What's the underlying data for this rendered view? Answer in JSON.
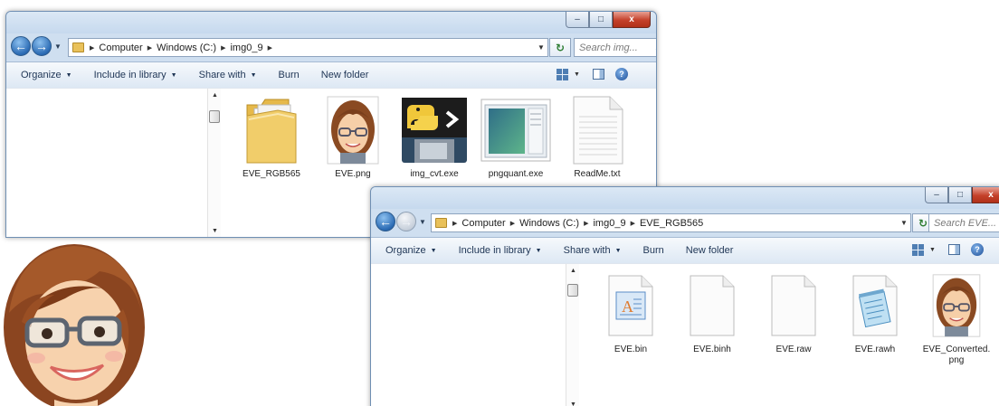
{
  "window1": {
    "caption": {
      "minimize": "–",
      "maximize": "□",
      "close": "x"
    },
    "address": {
      "crumbs": [
        "Computer",
        "Windows (C:)",
        "img0_9"
      ]
    },
    "search": {
      "placeholder": "Search img..."
    },
    "toolbar": {
      "items": [
        "Organize",
        "Include in library",
        "Share with",
        "Burn",
        "New folder"
      ]
    },
    "files": [
      {
        "name": "EVE_RGB565",
        "icon": "folder-icon"
      },
      {
        "name": "EVE.png",
        "icon": "eve-avatar-icon"
      },
      {
        "name": "img_cvt.exe",
        "icon": "python-floppy-icon"
      },
      {
        "name": "pngquant.exe",
        "icon": "app-window-icon"
      },
      {
        "name": "ReadMe.txt",
        "icon": "text-file-icon"
      }
    ]
  },
  "window2": {
    "caption": {
      "minimize": "–",
      "maximize": "□",
      "close": "x"
    },
    "address": {
      "crumbs": [
        "Computer",
        "Windows (C:)",
        "img0_9",
        "EVE_RGB565"
      ]
    },
    "search": {
      "placeholder": "Search EVE..."
    },
    "toolbar": {
      "items": [
        "Organize",
        "Include in library",
        "Share with",
        "Burn",
        "New folder"
      ]
    },
    "files": [
      {
        "name": "EVE.bin",
        "icon": "bin-file-icon"
      },
      {
        "name": "EVE.binh",
        "icon": "blank-file-icon"
      },
      {
        "name": "EVE.raw",
        "icon": "blank-file-icon"
      },
      {
        "name": "EVE.rawh",
        "icon": "notepad-file-icon"
      },
      {
        "name": "EVE_Converted.png",
        "icon": "eve-avatar-icon"
      }
    ]
  },
  "colors": {
    "window_frame": "#cfdff0",
    "toolbar_text": "#1e3555",
    "nav_button": "#2b6bb4",
    "close_button": "#c4402a"
  }
}
